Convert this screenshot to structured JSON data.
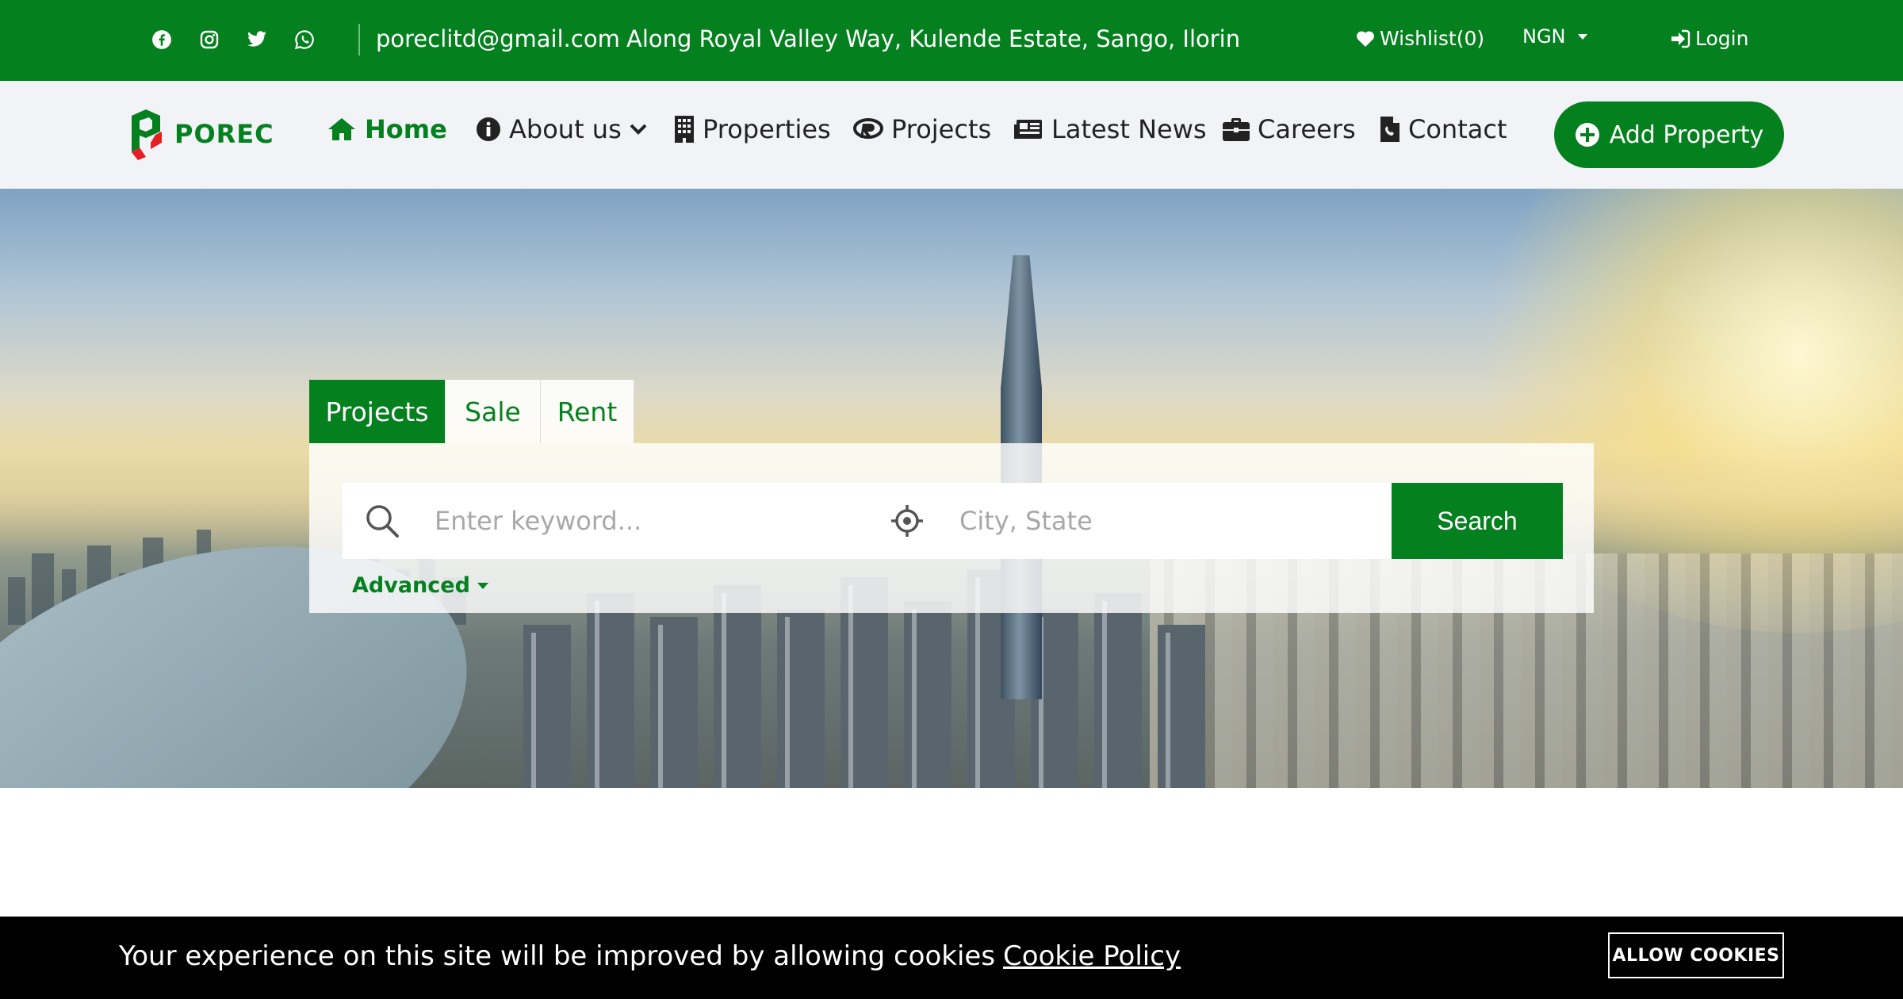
{
  "topbar": {
    "social": [
      "facebook-icon",
      "instagram-icon",
      "twitter-icon",
      "whatsapp-icon"
    ],
    "email": "poreclitd@gmail.com",
    "address": "Along Royal Valley Way, Kulende Estate, Sango, Ilorin",
    "wishlist_label": "Wishlist(0)",
    "currency": "NGN",
    "login_label": "Login"
  },
  "navbar": {
    "brand": "POREC",
    "items": [
      {
        "label": "Home",
        "icon": "home-icon"
      },
      {
        "label": "About us",
        "icon": "info-icon"
      },
      {
        "label": "Properties",
        "icon": "building-icon"
      },
      {
        "label": "Projects",
        "icon": "projects-icon"
      },
      {
        "label": "Latest News",
        "icon": "newspaper-icon"
      },
      {
        "label": "Careers",
        "icon": "briefcase-icon"
      },
      {
        "label": "Contact",
        "icon": "contact-file-icon"
      }
    ],
    "add_property_label": "Add Property"
  },
  "search": {
    "tabs": [
      "Projects",
      "Sale",
      "Rent"
    ],
    "active_tab": "Projects",
    "keyword_placeholder": "Enter keyword...",
    "location_placeholder": "City, State",
    "button_label": "Search",
    "advanced_label": "Advanced"
  },
  "cookie": {
    "message": "Your experience on this site will be improved by allowing cookies",
    "policy_link": "Cookie Policy",
    "allow_label": "ALLOW COOKIES"
  },
  "colors": {
    "brand_green": "#05801f",
    "nav_background": "#f2f3f7",
    "cookie_background": "#000000"
  }
}
